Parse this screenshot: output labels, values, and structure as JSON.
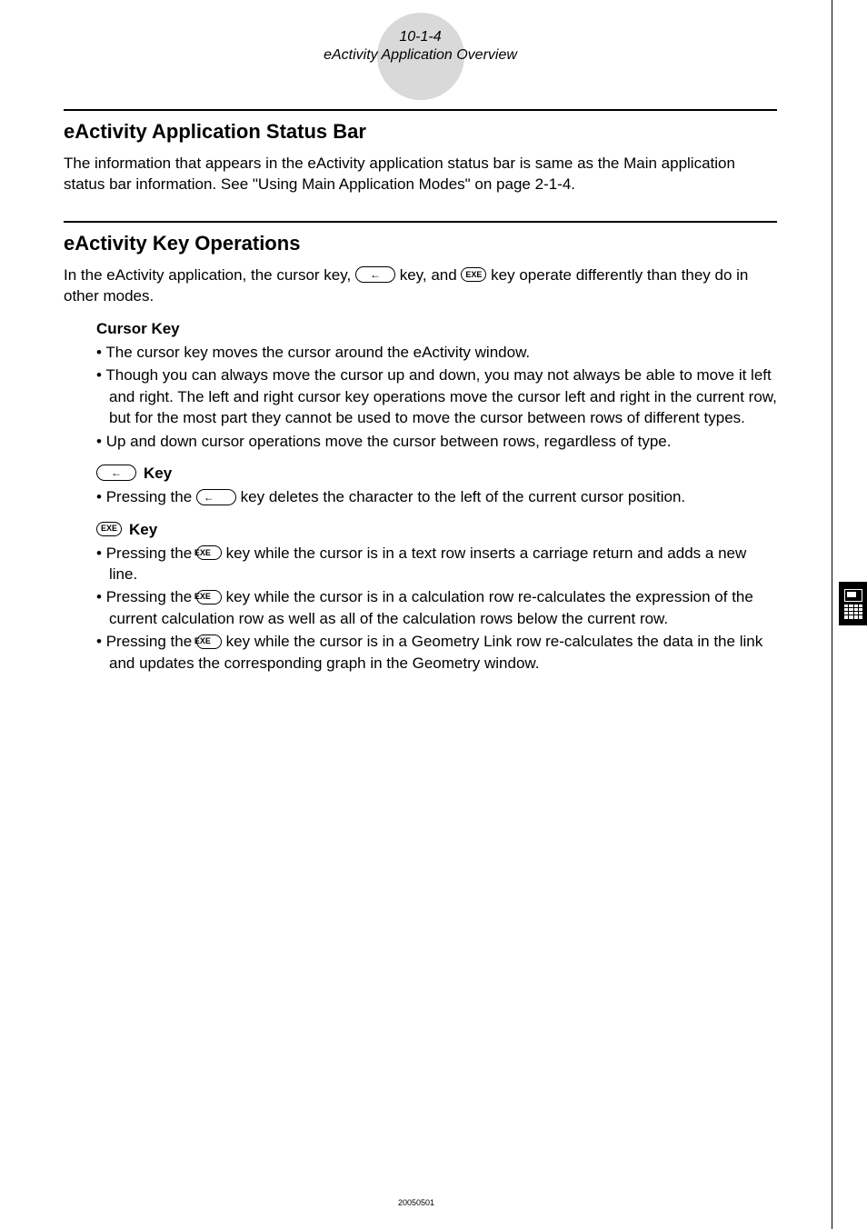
{
  "header": {
    "page_number": "10-1-4",
    "subtitle": "eActivity Application Overview"
  },
  "section1": {
    "title": "eActivity Application Status Bar",
    "para": "The information that appears in the eActivity application status bar is same as the Main application status bar information. See \"Using Main Application Modes\" on page 2-1-4."
  },
  "section2": {
    "title": "eActivity Key Operations",
    "intro_a": "In the eActivity application, the cursor key, ",
    "intro_b": " key, and ",
    "intro_c": " key operate differently than they do in other modes.",
    "cursor": {
      "heading": "Cursor Key",
      "b1": "The cursor key moves the cursor around the eActivity window.",
      "b2": "Though you can always move the cursor up and down, you may not always be able to move it left and right. The left and right cursor key operations move the cursor left and right in the current row, but for the most part they cannot be used to move the cursor between rows of different types.",
      "b3": "Up and down cursor operations move the cursor between rows, regardless of type."
    },
    "backkey": {
      "heading_suffix": " Key",
      "b1_a": "Pressing the ",
      "b1_b": " key deletes the character to the left of the current cursor position."
    },
    "exekey": {
      "heading_suffix": " Key",
      "b1_a": "Pressing the ",
      "b1_b": " key while the cursor is in a text row inserts a carriage return and adds a new line.",
      "b2_a": "Pressing the ",
      "b2_b": " key while the cursor is in a calculation row re-calculates the expression of the current calculation row as well as all of the calculation rows below the current row.",
      "b3_a": "Pressing the ",
      "b3_b": " key while the cursor is in a Geometry Link row re-calculates the data in the link and updates the corresponding graph in the Geometry window."
    }
  },
  "keys": {
    "back_glyph": "←",
    "exe_label": "EXE"
  },
  "footer": {
    "date": "20050501"
  }
}
